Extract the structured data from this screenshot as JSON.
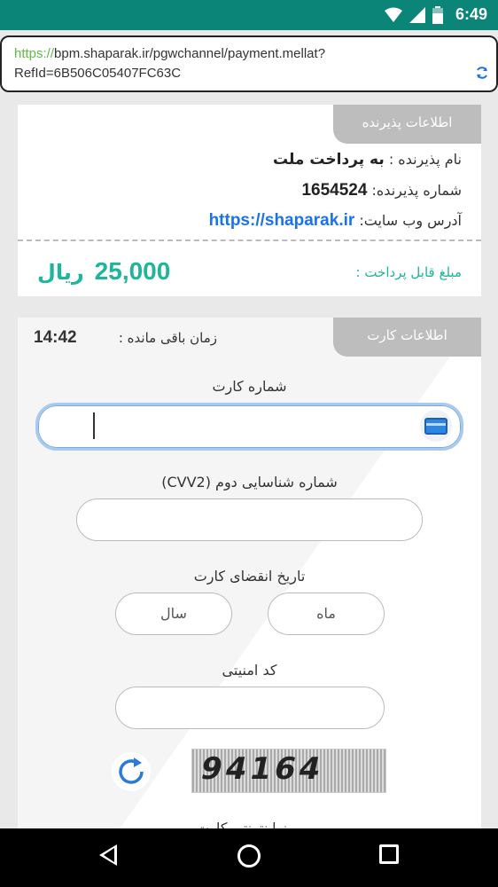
{
  "status": {
    "time": "6:49"
  },
  "browser": {
    "url_scheme": "https://",
    "url_rest": "bpm.shaparak.ir/pgwchannel/payment.mellat?",
    "url_line2": "RefId=6B506C05407FC63C"
  },
  "merchant": {
    "tab_title": "اطلاعات پذیرنده",
    "name_label": "نام پذیرنده :",
    "name_value": "به پرداخت ملت",
    "number_label": "شماره پذیرنده:",
    "number_value": "1654524",
    "site_label": "آدرس وب سایت:",
    "site_value": "https://shaparak.ir",
    "amount_label": "مبلغ قابل پرداخت :",
    "amount_value": "25,000",
    "amount_unit": "ریال"
  },
  "card": {
    "tab_title": "اطلاعات کارت",
    "timer_label": "زمان باقی مانده :",
    "timer_value": "14:42",
    "card_number_label": "شماره کارت",
    "cvv2_label": "شماره شناسایی دوم (CVV2)",
    "expiry_label": "تاریخ انقضای کارت",
    "month_placeholder": "ماه",
    "year_placeholder": "سال",
    "security_code_label": "کد امنیتی",
    "captcha_text": "94164",
    "next_label": "رمز اینترنتی کارت"
  }
}
